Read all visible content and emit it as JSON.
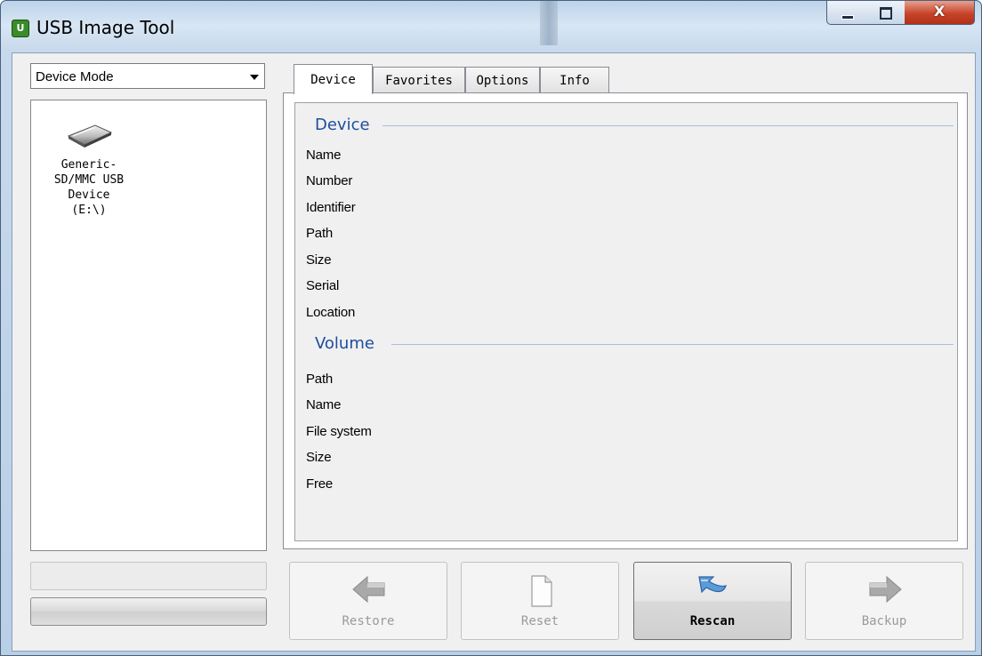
{
  "window": {
    "title": "USB Image Tool",
    "app_icon": "U"
  },
  "caption_buttons": {
    "close_glyph": "X"
  },
  "sidebar": {
    "mode": {
      "selected": "Device Mode"
    },
    "devices": [
      {
        "label": "Generic-\nSD/MMC USB\nDevice\n(E:\\)",
        "icon": "usb-drive-icon"
      }
    ]
  },
  "tabs": [
    {
      "label": "Device",
      "active": true
    },
    {
      "label": "Favorites",
      "active": false
    },
    {
      "label": "Options",
      "active": false
    },
    {
      "label": "Info",
      "active": false
    }
  ],
  "device_tab": {
    "device_group": {
      "title": "Device",
      "fields": [
        "Name",
        "Number",
        "Identifier",
        "Path",
        "Size",
        "Serial",
        "Location"
      ]
    },
    "volume_group": {
      "title": "Volume",
      "fields": [
        "Path",
        "Name",
        "File system",
        "Size",
        "Free"
      ]
    }
  },
  "actions": [
    {
      "label": "Restore",
      "enabled": false,
      "icon": "arrow-left-icon"
    },
    {
      "label": "Reset",
      "enabled": false,
      "icon": "document-icon"
    },
    {
      "label": "Rescan",
      "enabled": true,
      "icon": "rescan-arrow-icon"
    },
    {
      "label": "Backup",
      "enabled": false,
      "icon": "arrow-right-icon"
    }
  ],
  "colors": {
    "group_title": "#1e4d9e",
    "close_button": "#c7442a",
    "app_icon": "#3a8b2a"
  }
}
